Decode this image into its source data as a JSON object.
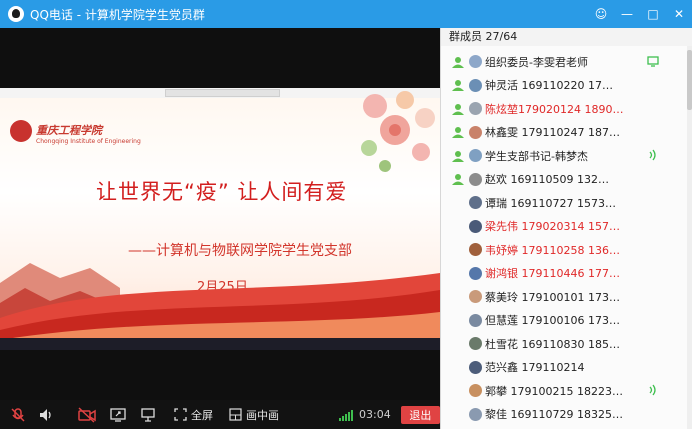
{
  "window": {
    "title": "QQ电话 - 计算机学院学生党员群",
    "controls": [
      "☺",
      "—",
      "□",
      "✕"
    ]
  },
  "slide": {
    "school_name": "重庆工程学院",
    "school_sub": "Chongqing Institute of Engineering",
    "main_title": "让世界无“疫”  让人间有爱",
    "sub_title": "——计算机与物联网学院学生党支部",
    "date": "2月25日"
  },
  "toolbar": {
    "fullscreen_label": "全屏",
    "pip_label": "画中画",
    "timer": "03:04",
    "exit_label": "退出"
  },
  "panel": {
    "header": "群成员 27/64",
    "members": [
      {
        "name": "组织委员-李雯君老师",
        "red": false,
        "mic": true,
        "right": "screen",
        "av": "#8da7c9"
      },
      {
        "name": "钟灵活   169110220   17…",
        "red": false,
        "mic": true,
        "right": "",
        "av": "#6b8fb5"
      },
      {
        "name": "陈炫堃179020124 1890…",
        "red": true,
        "mic": true,
        "right": "",
        "av": "#9aa4b0"
      },
      {
        "name": "林鑫雯 179110247 187…",
        "red": false,
        "mic": true,
        "right": "",
        "av": "#c9826a"
      },
      {
        "name": "学生支部书记-韩梦杰",
        "red": false,
        "mic": true,
        "right": "sound",
        "av": "#7fa0c2"
      },
      {
        "name": "赵欢    169110509   132…",
        "red": false,
        "mic": true,
        "right": "",
        "av": "#8c8c8c"
      },
      {
        "name": "谭瑞  169110727  1573…",
        "red": false,
        "mic": false,
        "right": "",
        "av": "#5f6f8a"
      },
      {
        "name": "梁先伟 179020314 157…",
        "red": true,
        "mic": false,
        "right": "",
        "av": "#4a5a78"
      },
      {
        "name": "韦妤婷 179110258 136…",
        "red": true,
        "mic": false,
        "right": "",
        "av": "#a0603c"
      },
      {
        "name": "谢鸿银 179110446 177…",
        "red": true,
        "mic": false,
        "right": "",
        "av": "#5577aa"
      },
      {
        "name": "蔡美玲 179100101 173…",
        "red": false,
        "mic": false,
        "right": "",
        "av": "#c99a7a"
      },
      {
        "name": "但慧莲 179100106 173…",
        "red": false,
        "mic": false,
        "right": "",
        "av": "#7a8aa0"
      },
      {
        "name": "杜雪花 169110830 185…",
        "red": false,
        "mic": false,
        "right": "",
        "av": "#6a7a6a"
      },
      {
        "name": "范兴鑫  179110214",
        "red": false,
        "mic": false,
        "right": "",
        "av": "#4d5d7a"
      },
      {
        "name": "郭攀 179100215 18223…",
        "red": false,
        "mic": false,
        "right": "sound",
        "av": "#c89060"
      },
      {
        "name": "黎佳 169110729 18325…",
        "red": false,
        "mic": false,
        "right": "",
        "av": "#8a9ab0"
      }
    ]
  }
}
